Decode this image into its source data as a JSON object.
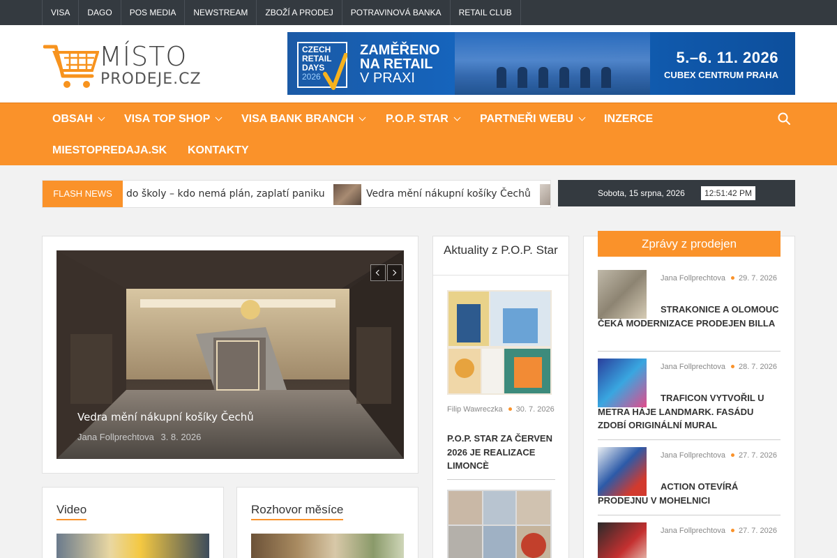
{
  "topbar": {
    "links": [
      "VISA",
      "DAGO",
      "POS MEDIA",
      "NEWSTREAM",
      "ZBOŽÍ A PRODEJ",
      "POTRAVINOVÁ BANKA",
      "RETAIL CLUB"
    ]
  },
  "logo": {
    "line1": "MÍSTO",
    "line2": "PRODEJE.CZ"
  },
  "banner": {
    "badge_line1": "CZECH",
    "badge_line2": "RETAIL",
    "badge_line3": "DAYS",
    "badge_year": "2026",
    "headline_1": "ZAMĚŘENO",
    "headline_2": "NA RETAIL",
    "headline_3": "V PRAXI",
    "dates": "5.–6. 11. 2026",
    "place": "CUBEX CENTRUM PRAHA"
  },
  "nav": {
    "items": [
      "OBSAH",
      "VISA TOP SHOP",
      "VISA BANK BRANCH",
      "P.O.P. STAR",
      "PARTNEŘI WEBU",
      "INZERCE",
      "MIESTOPREDAJA.SK",
      "KONTAKTY"
    ]
  },
  "flash": {
    "label": "FLASH NEWS",
    "items": [
      "do školy – kdo nemá plán, zaplatí paniku",
      "Vedra mění nákupní košíky Čechů"
    ]
  },
  "datebar": {
    "date": "Sobota, 15 srpna, 2026",
    "time": "12:51:42 PM"
  },
  "slider": {
    "caption": "Vedra mění nákupní košíky Čechů",
    "author": "Jana Follprechtova",
    "date": "3. 8. 2026"
  },
  "popstar": {
    "heading": "Aktuality z P.O.P. Star",
    "article": {
      "author": "Filip Wawreczka",
      "date": "30. 7. 2026",
      "title": "P.O.P. STAR ZA ČERVEN 2026 JE REALIZACE LIMONCÈ"
    }
  },
  "news": {
    "heading": "Zprávy z prodejen",
    "articles": [
      {
        "author": "Jana Follprechtova",
        "date": "29. 7. 2026",
        "title": "STRAKONICE A OLOMOUC ČEKÁ MODERNIZACE PRODEJEN BILLA"
      },
      {
        "author": "Jana Follprechtova",
        "date": "28. 7. 2026",
        "title": "TRAFICON VYTVOŘIL U METRA HÁJE LANDMARK. FASÁDU ZDOBÍ ORIGINÁLNÍ MURAL"
      },
      {
        "author": "Jana Follprechtova",
        "date": "27. 7. 2026",
        "title": "ACTION OTEVÍRÁ PRODEJNU V MOHELNICI"
      },
      {
        "author": "Jana Follprechtova",
        "date": "27. 7. 2026",
        "title": ""
      }
    ]
  },
  "video": {
    "heading": "Video"
  },
  "rozhovor": {
    "heading": "Rozhovor měsíce"
  },
  "colors": {
    "accent": "#fa922a",
    "dark": "#343a40"
  }
}
